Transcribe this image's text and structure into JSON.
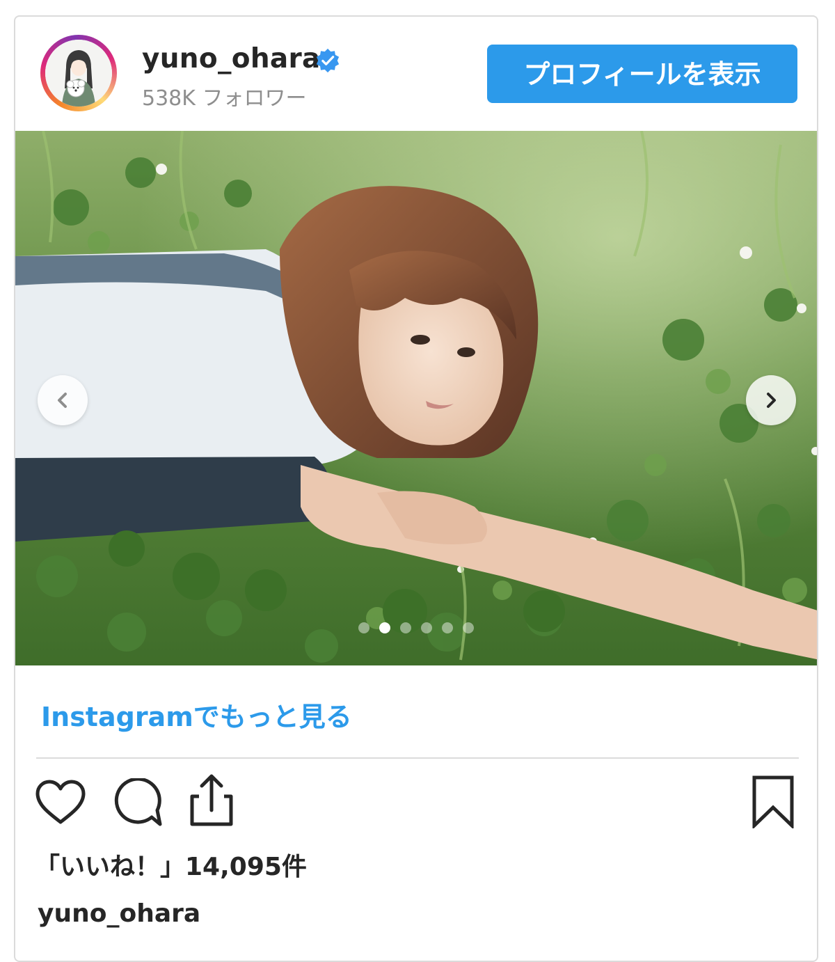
{
  "post": {
    "username": "yuno_ohara",
    "followers": "538K フォロワー",
    "verified": true,
    "profile_button": "プロフィールを表示",
    "more_link": "Instagramでもっと見る",
    "likes": "「いいね！」14,095件",
    "caption_username": "yuno_ohara"
  },
  "carousel": {
    "slide_count": 6,
    "active_index": 1
  },
  "icons": {
    "avatar": "avatar-illustration",
    "verified": "verified-badge-icon",
    "prev": "chevron-left-icon",
    "next": "chevron-right-icon",
    "like": "heart-icon",
    "comment": "comment-icon",
    "share": "share-icon",
    "save": "bookmark-icon"
  },
  "colors": {
    "accent": "#2c9aea",
    "text": "#262626",
    "muted": "#8e8e8e",
    "border": "#dbdbdb"
  }
}
